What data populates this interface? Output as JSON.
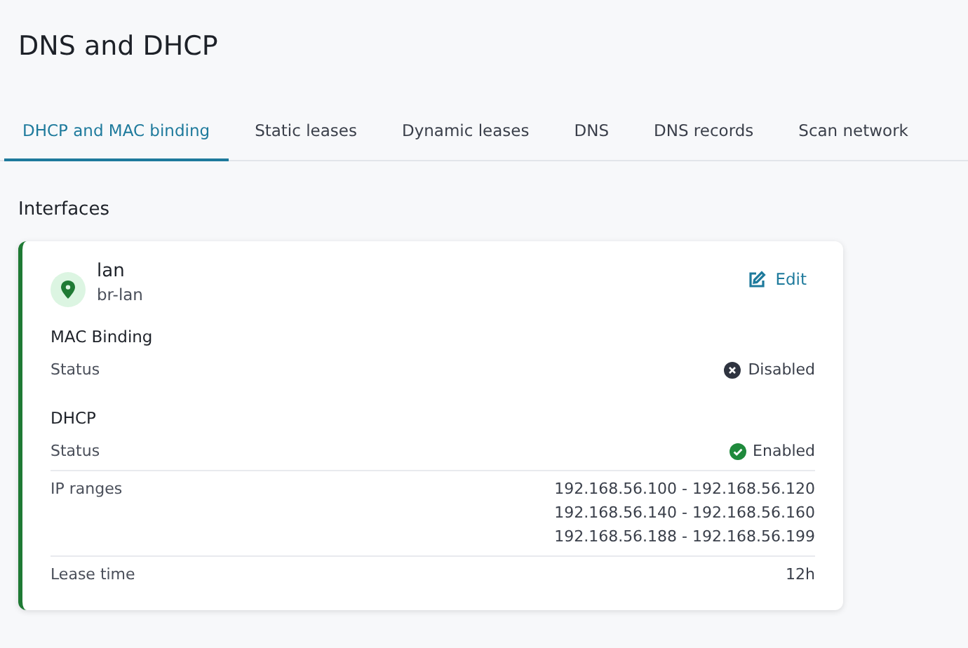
{
  "page_title": "DNS and DHCP",
  "tabs": [
    {
      "label": "DHCP and MAC binding",
      "selected": true
    },
    {
      "label": "Static leases",
      "selected": false
    },
    {
      "label": "Dynamic leases",
      "selected": false
    },
    {
      "label": "DNS",
      "selected": false
    },
    {
      "label": "DNS records",
      "selected": false
    },
    {
      "label": "Scan network",
      "selected": false
    }
  ],
  "section_title": "Interfaces",
  "interface": {
    "name": "lan",
    "device": "br-lan",
    "edit_label": "Edit",
    "sections": [
      {
        "title": "MAC Binding",
        "rows": [
          {
            "kind": "status",
            "label": "Status",
            "enabled": false,
            "values": [
              "Disabled"
            ]
          }
        ]
      },
      {
        "title": "DHCP",
        "rows": [
          {
            "kind": "status",
            "label": "Status",
            "enabled": true,
            "values": [
              "Enabled"
            ]
          },
          {
            "kind": "text",
            "label": "IP ranges",
            "values": [
              "192.168.56.100 - 192.168.56.120",
              "192.168.56.140 - 192.168.56.160",
              "192.168.56.188 - 192.168.56.199"
            ]
          },
          {
            "kind": "text",
            "label": "Lease time",
            "values": [
              "12h"
            ]
          }
        ]
      }
    ]
  }
}
